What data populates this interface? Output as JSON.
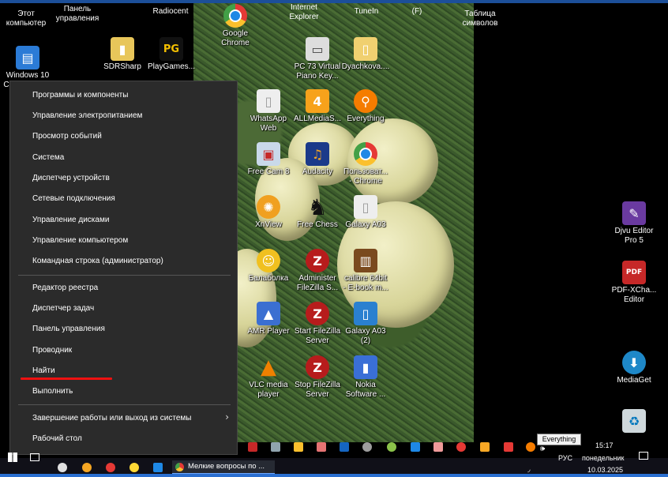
{
  "desktop": {
    "top_labels": [
      {
        "id": "this-pc",
        "text": "Этот\nкомпьютер"
      },
      {
        "id": "control-panel",
        "text": "Панель\nуправления"
      },
      {
        "id": "radiocent",
        "text": "Radiocent"
      },
      {
        "id": "internet-explorer",
        "text": "Internet\nExplorer"
      },
      {
        "id": "tunein",
        "text": "TuneIn"
      },
      {
        "id": "f-drive",
        "text": "(F)"
      },
      {
        "id": "charmap",
        "text": "Таблица\nсимволов"
      }
    ],
    "icons": [
      {
        "id": "windows10",
        "label": "Windows 10\nCorporate (C)",
        "color": "#2b7bd6",
        "glyph": "▤"
      },
      {
        "id": "sdrsharp",
        "label": "SDRSharp",
        "color": "#e8c65a",
        "glyph": "▮"
      },
      {
        "id": "playgames",
        "label": "PlayGames...",
        "color": "#111",
        "glyph": "PG"
      },
      {
        "id": "google-chrome",
        "label": "Google\nChrome",
        "color": "#e53935",
        "glyph": "◉"
      },
      {
        "id": "pc73",
        "label": "PC 73 Virtual\nPiano Key...",
        "color": "#ddd",
        "glyph": "▭"
      },
      {
        "id": "dyachkova",
        "label": "Dyachkova....",
        "color": "#f0d070",
        "glyph": "▯"
      },
      {
        "id": "whatsapp-web",
        "label": "WhatsApp\nWeb",
        "color": "#eee",
        "glyph": "▯"
      },
      {
        "id": "allmedia",
        "label": "ALLMediaS...",
        "color": "#f7a21b",
        "glyph": "4"
      },
      {
        "id": "everything",
        "label": "Everything",
        "color": "#f57c00",
        "glyph": "⚲"
      },
      {
        "id": "freecam",
        "label": "Free Cam 8",
        "color": "#c9d9ea",
        "glyph": "▣"
      },
      {
        "id": "audacity",
        "label": "Audacity",
        "color": "#1b3a8a",
        "glyph": "♫"
      },
      {
        "id": "user-chrome",
        "label": "Пользоват...\n- Chrome",
        "color": "#e53935",
        "glyph": "◉"
      },
      {
        "id": "xnview",
        "label": "XnView",
        "color": "#f0a020",
        "glyph": "✺"
      },
      {
        "id": "freechess",
        "label": "Free Chess",
        "color": "#222",
        "glyph": "♞"
      },
      {
        "id": "galaxy-a03",
        "label": "Galaxy A03",
        "color": "#eee",
        "glyph": "▯"
      },
      {
        "id": "balabolka",
        "label": "Балаболка",
        "color": "#f0c020",
        "glyph": "☺"
      },
      {
        "id": "admin-filezilla",
        "label": "Administer\nFileZilla S...",
        "color": "#b71c1c",
        "glyph": "Z"
      },
      {
        "id": "calibre",
        "label": "calibre 64bit\n- E-book m...",
        "color": "#7a4a1e",
        "glyph": "▥"
      },
      {
        "id": "aimp",
        "label": "AMR Player",
        "color": "#3b6fd1",
        "glyph": "▲"
      },
      {
        "id": "start-filezilla",
        "label": "Start FileZilla\nServer",
        "color": "#b71c1c",
        "glyph": "Z"
      },
      {
        "id": "galaxy-a03-2",
        "label": "Galaxy A03\n(2)",
        "color": "#2a80d0",
        "glyph": "▯"
      },
      {
        "id": "vlc",
        "label": "VLC media\nplayer",
        "color": "#f08000",
        "glyph": "▲"
      },
      {
        "id": "stop-filezilla",
        "label": "Stop FileZilla\nServer",
        "color": "#b71c1c",
        "glyph": "Z"
      },
      {
        "id": "nokia",
        "label": "Nokia\nSoftware ...",
        "color": "#3a6fd6",
        "glyph": "▮"
      },
      {
        "id": "djvu",
        "label": "Djvu Editor\nPro 5",
        "color": "#6a3aa0",
        "glyph": "✎"
      },
      {
        "id": "pdfxchange",
        "label": "PDF-XCha...\nEditor",
        "color": "#c62828",
        "glyph": "PDF"
      },
      {
        "id": "mediaget",
        "label": "MediaGet",
        "color": "#1e88c8",
        "glyph": "⬇"
      },
      {
        "id": "recycle",
        "label": "",
        "color": "#cfd8dc",
        "glyph": "♻"
      }
    ]
  },
  "context_menu": {
    "group1": [
      "Программы и компоненты",
      "Управление электропитанием",
      "Просмотр событий",
      "Система",
      "Диспетчер устройств",
      "Сетевые подключения",
      "Управление дисками",
      "Управление компьютером",
      "Командная строка (администратор)"
    ],
    "group2": [
      "Редактор реестра",
      "Диспетчер задач",
      "Панель управления",
      "Проводник",
      "Найти",
      "Выполнить"
    ],
    "group3": [
      "Завершение работы или выход из системы",
      "Рабочий стол"
    ],
    "highlight_color": "#e11"
  },
  "taskbar": {
    "active_window": "Мелкие вопросы по ...",
    "tooltip": "Everything",
    "language": "РУС",
    "time": "15:17",
    "day": "понедельник",
    "date": "10.03.2025"
  }
}
